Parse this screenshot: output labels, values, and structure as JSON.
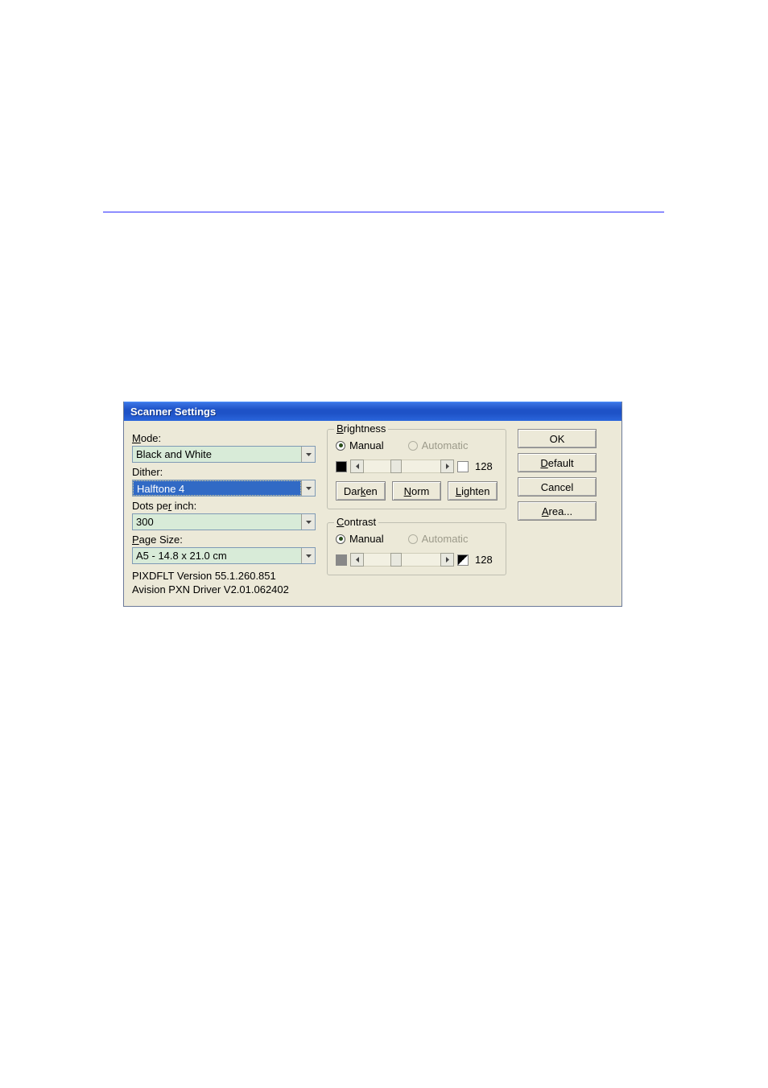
{
  "window": {
    "title": "Scanner Settings"
  },
  "left": {
    "mode_label": "ode:",
    "mode_prefix": "M",
    "mode_value": "Black and White",
    "dither_label": "D",
    "dither_rest": "ither:",
    "dither_value": "Halftone 4",
    "dpi_label_pre": "Dots pe",
    "dpi_label_ul": "r",
    "dpi_label_post": " inch:",
    "dpi_value": "300",
    "page_label_ul": "P",
    "page_label_rest": "age Size:",
    "page_value": "A5 - 14.8 x 21.0 cm",
    "version1": "PIXDFLT Version 55.1.260.851",
    "version2": "Avision PXN Driver V2.01.062402"
  },
  "brightness": {
    "title_ul": "B",
    "title_rest": "rightness",
    "manual_label": "Manual",
    "automatic_label": "Automatic",
    "value": "128",
    "darken_pre": "Dar",
    "darken_ul": "k",
    "darken_post": "en",
    "norm_ul": "N",
    "norm_rest": "orm",
    "lighten_ul": "L",
    "lighten_rest": "ighten"
  },
  "contrast": {
    "title_ul": "C",
    "title_rest": "ontrast",
    "manual_label": "Manual",
    "automatic_label": "Automatic",
    "value": "128"
  },
  "buttons": {
    "ok": "OK",
    "default_ul": "D",
    "default_rest": "efault",
    "cancel": "Cancel",
    "area_ul": "A",
    "area_rest": "rea..."
  }
}
